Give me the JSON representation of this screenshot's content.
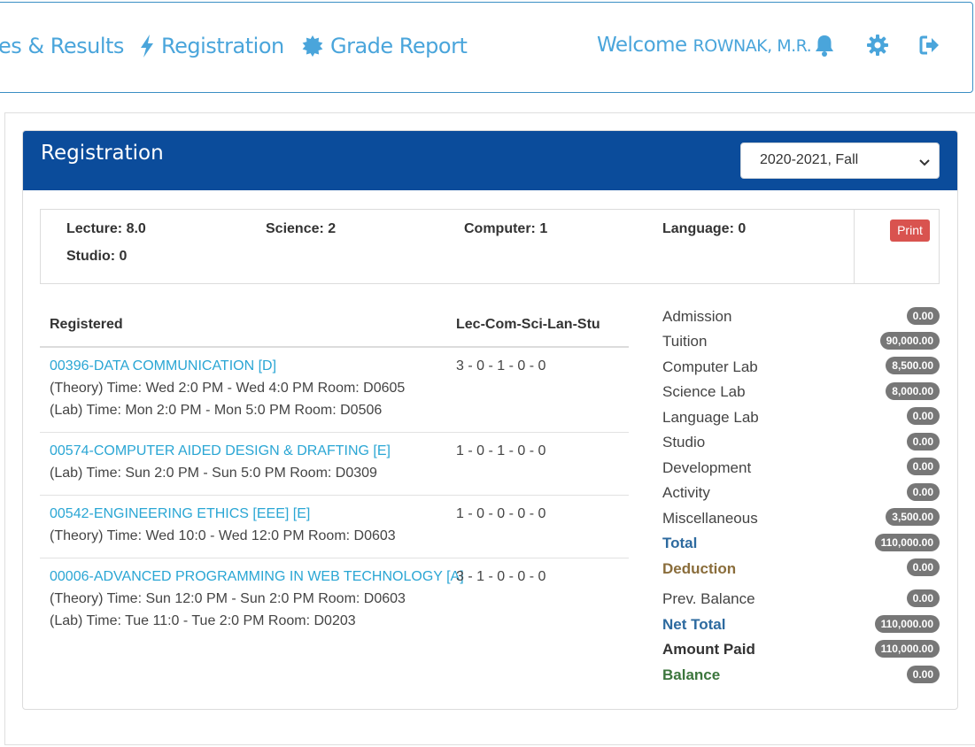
{
  "nav": {
    "items": [
      {
        "label": "es & Results",
        "icon": "none"
      },
      {
        "label": "Registration",
        "icon": "bolt-icon"
      },
      {
        "label": "Grade Report",
        "icon": "certificate-icon"
      }
    ],
    "welcome_prefix": "Welcome",
    "user_name": "ROWNAK, M.R.",
    "icons": [
      "bell-icon",
      "gear-icon",
      "sign-out-icon"
    ],
    "accent": "#4aa5db"
  },
  "card": {
    "title": "Registration",
    "semester": "2020-2021, Fall",
    "header_color": "#0b4c9b"
  },
  "summary": {
    "lecture": "Lecture: 8.0",
    "science": "Science: 2",
    "computer": "Computer: 1",
    "language": "Language: 0",
    "studio": "Studio: 0",
    "print_label": "Print"
  },
  "table": {
    "col_registered": "Registered",
    "col_lcs": "Lec-Com-Sci-Lan-Stu",
    "courses": [
      {
        "title": "00396-DATA COMMUNICATION [D]",
        "lcs": "3 - 0 - 1 - 0 - 0",
        "times": [
          "(Theory) Time: Wed 2:0 PM - Wed 4:0 PM Room: D0605",
          "(Lab) Time: Mon 2:0 PM - Mon 5:0 PM Room: D0506"
        ]
      },
      {
        "title": "00574-COMPUTER AIDED DESIGN & DRAFTING [E]",
        "lcs": "1 - 0 - 1 - 0 - 0",
        "times": [
          "(Lab) Time: Sun 2:0 PM - Sun 5:0 PM Room: D0309"
        ]
      },
      {
        "title": "00542-ENGINEERING ETHICS [EEE] [E]",
        "lcs": "1 - 0 - 0 - 0 - 0",
        "times": [
          "(Theory) Time: Wed 10:0 - Wed 12:0 PM Room: D0603"
        ]
      },
      {
        "title": "00006-ADVANCED PROGRAMMING IN WEB TECHNOLOGY [A]",
        "lcs": "3 - 1 - 0 - 0 - 0",
        "times": [
          "(Theory) Time: Sun 12:0 PM - Sun 2:0 PM Room: D0603",
          "(Lab) Time: Tue 11:0 - Tue 2:0 PM Room: D0203"
        ]
      }
    ]
  },
  "fees": [
    {
      "label": "Admission",
      "value": "0.00",
      "style": "normal"
    },
    {
      "label": "Tuition",
      "value": "90,000.00",
      "style": "normal"
    },
    {
      "label": "Computer Lab",
      "value": "8,500.00",
      "style": "normal"
    },
    {
      "label": "Science Lab",
      "value": "8,000.00",
      "style": "normal"
    },
    {
      "label": "Language Lab",
      "value": "0.00",
      "style": "normal"
    },
    {
      "label": "Studio",
      "value": "0.00",
      "style": "normal"
    },
    {
      "label": "Development",
      "value": "0.00",
      "style": "normal"
    },
    {
      "label": "Activity",
      "value": "0.00",
      "style": "normal"
    },
    {
      "label": "Miscellaneous",
      "value": "3,500.00",
      "style": "normal"
    },
    {
      "label": "Total",
      "value": "110,000.00",
      "style": "total"
    },
    {
      "label": "Deduction",
      "value": "0.00",
      "style": "deduction"
    },
    {
      "label": "Prev. Balance",
      "value": "0.00",
      "style": "normal"
    },
    {
      "label": "Net Total",
      "value": "110,000.00",
      "style": "total"
    },
    {
      "label": "Amount Paid",
      "value": "110,000.00",
      "style": "paid"
    },
    {
      "label": "Balance",
      "value": "0.00",
      "style": "balance"
    }
  ]
}
